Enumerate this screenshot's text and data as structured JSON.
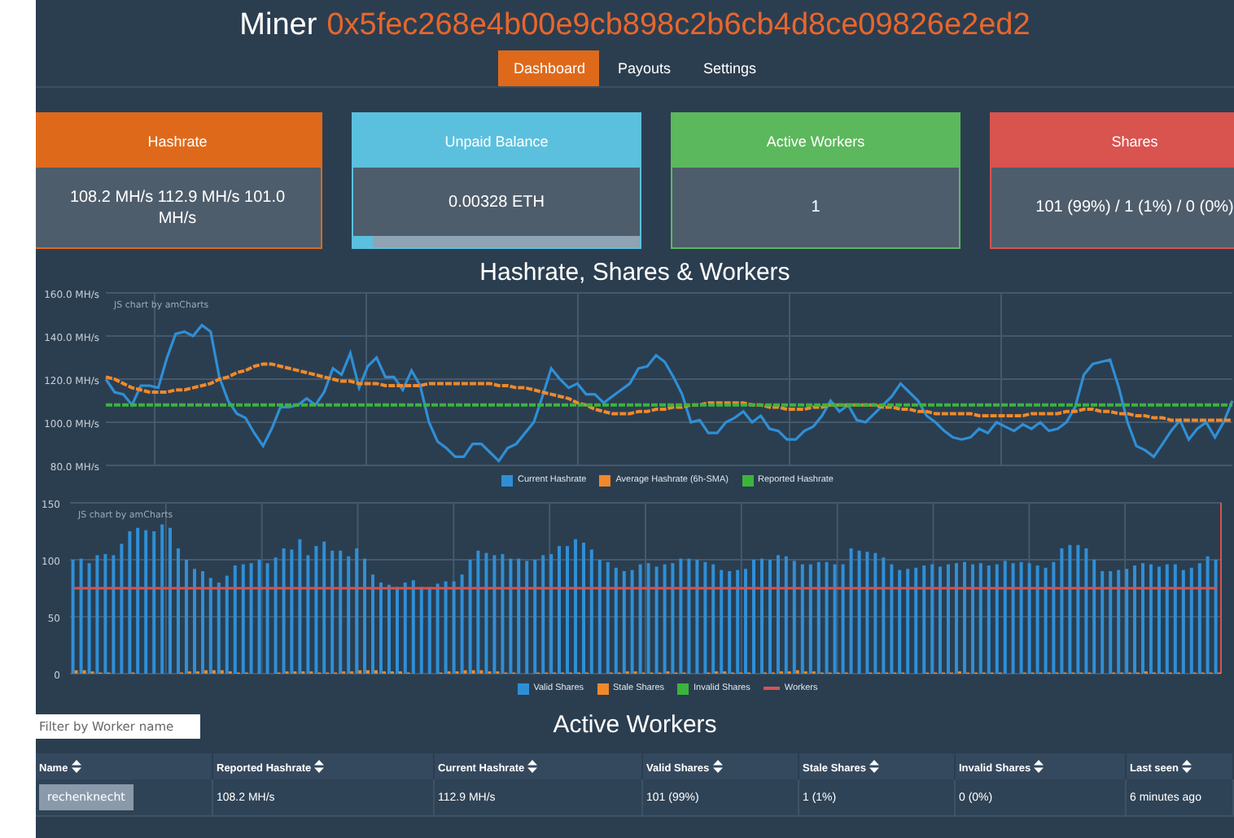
{
  "header": {
    "title_label": "Miner",
    "address": "0x5fec268e4b00e9cb898c2b6cb4d8ce09826e2ed2"
  },
  "tabs": [
    {
      "label": "Dashboard",
      "selected": true
    },
    {
      "label": "Payouts",
      "selected": false
    },
    {
      "label": "Settings",
      "selected": false
    }
  ],
  "cards": [
    {
      "title": "Hashrate",
      "value": "108.2 MH/s 112.9 MH/s 101.0 MH/s",
      "color": "#df691a"
    },
    {
      "title": "Unpaid Balance",
      "value": "0.00328 ETH",
      "color": "#5bc0de",
      "level": 0.07
    },
    {
      "title": "Active Workers",
      "value": "1",
      "color": "#5cb85c"
    },
    {
      "title": "Shares",
      "value": "101 (99%) / 1 (1%) / 0 (0%)",
      "color": "#d9534f"
    }
  ],
  "charts_title": "Hashrate, Shares & Workers",
  "hashrate_chart": {
    "credit": "JS chart by amCharts",
    "chart_data": {
      "type": "line",
      "ylim": [
        80,
        160
      ],
      "grid": true,
      "legend": true,
      "yticks": [
        {
          "value": 80,
          "label": "80.0 MH/s"
        },
        {
          "value": 100,
          "label": "100.0 MH/s"
        },
        {
          "value": 120,
          "label": "120.0 MH/s"
        },
        {
          "value": 140,
          "label": "140.0 MH/s"
        },
        {
          "value": 160,
          "label": "160.0 MH/s"
        }
      ],
      "series": [
        {
          "name": "Current Hashrate",
          "color": "#2f8fd6",
          "line_style": "solid",
          "values": [
            120,
            114,
            113,
            108,
            117,
            117,
            116,
            130,
            141,
            142,
            140,
            145,
            142,
            121,
            110,
            104,
            102,
            95,
            89,
            97,
            107,
            107,
            108,
            111,
            108,
            114,
            125,
            122,
            132,
            116,
            126,
            130,
            121,
            121,
            115,
            124,
            117,
            100,
            91,
            88,
            84,
            84,
            90,
            90,
            86,
            82,
            88,
            90,
            95,
            100,
            112,
            125,
            120,
            116,
            118,
            113,
            113,
            109,
            112,
            115,
            118,
            125,
            126,
            131,
            128,
            121,
            113,
            100,
            101,
            95,
            95,
            100,
            102,
            105,
            100,
            103,
            97,
            96,
            92,
            92,
            96,
            98,
            103,
            110,
            105,
            108,
            101,
            100,
            104,
            108,
            112,
            118,
            114,
            110,
            103,
            100,
            96,
            93,
            92,
            93,
            97,
            95,
            100,
            98,
            96,
            99,
            97,
            100,
            96,
            97,
            100,
            107,
            122,
            127,
            128,
            129,
            116,
            100,
            89,
            87,
            84,
            90,
            96,
            101,
            92,
            97,
            100,
            93,
            100,
            110
          ]
        },
        {
          "name": "Average Hashrate (6h-SMA)",
          "color": "#f0892b",
          "line_style": "dashed",
          "values": [
            121,
            120,
            118,
            116,
            115,
            114,
            114,
            114,
            115,
            115,
            116,
            117,
            118,
            120,
            121,
            123,
            124,
            126,
            127,
            127,
            126,
            125,
            124,
            123,
            122,
            121,
            120,
            119,
            119,
            118,
            118,
            118,
            117,
            117,
            117,
            117,
            117,
            118,
            118,
            118,
            118,
            118,
            118,
            118,
            118,
            117,
            117,
            116,
            116,
            115,
            114,
            113,
            112,
            111,
            109,
            108,
            106,
            105,
            104,
            104,
            104,
            105,
            105,
            106,
            106,
            107,
            107,
            108,
            108,
            109,
            109,
            109,
            109,
            109,
            108,
            108,
            107,
            107,
            106,
            106,
            106,
            107,
            107,
            108,
            108,
            108,
            108,
            108,
            108,
            107,
            107,
            106,
            106,
            105,
            105,
            104,
            104,
            104,
            104,
            104,
            103,
            103,
            103,
            103,
            103,
            103,
            104,
            104,
            104,
            104,
            105,
            105,
            106,
            106,
            105,
            105,
            104,
            104,
            103,
            103,
            102,
            102,
            101,
            101,
            101,
            101,
            101,
            101,
            101,
            101
          ]
        },
        {
          "name": "Reported Hashrate",
          "color": "#3cb43c",
          "line_style": "dashed",
          "values": [
            108,
            108,
            108,
            108,
            108,
            108,
            108,
            108,
            108,
            108,
            108,
            108,
            108,
            108,
            108,
            108,
            108,
            108,
            108,
            108,
            108,
            108,
            108,
            108,
            108,
            108,
            108,
            108,
            108,
            108,
            108,
            108,
            108,
            108,
            108,
            108,
            108,
            108,
            108,
            108,
            108,
            108,
            108,
            108,
            108,
            108,
            108,
            108,
            108,
            108,
            108,
            108,
            108,
            108,
            108,
            108,
            108,
            108,
            108,
            108,
            108,
            108,
            108,
            108,
            108,
            108,
            108,
            108,
            108,
            108,
            108,
            108,
            108,
            108,
            108,
            108,
            108,
            108,
            108,
            108,
            108,
            108,
            108,
            108,
            108,
            108,
            108,
            108,
            108,
            108,
            108,
            108,
            108,
            108,
            108,
            108,
            108,
            108,
            108,
            108,
            108,
            108,
            108,
            108,
            108,
            108,
            108,
            108,
            108,
            108,
            108,
            108,
            108,
            108,
            108,
            108,
            108,
            108,
            108,
            108,
            108,
            108,
            108,
            108,
            108,
            108,
            108,
            108,
            108,
            108
          ]
        }
      ]
    }
  },
  "shares_chart": {
    "credit": "JS chart by amCharts",
    "chart_data": {
      "type": "bar",
      "ylim": [
        0,
        150
      ],
      "yticks": [
        0,
        50,
        100,
        150
      ],
      "stacked": false,
      "grid": true,
      "legend": true,
      "series": [
        {
          "name": "Valid Shares",
          "color": "#2f8fd6",
          "values": [
            100,
            101,
            97,
            104,
            105,
            104,
            114,
            125,
            128,
            126,
            125,
            131,
            128,
            110,
            100,
            92,
            90,
            84,
            80,
            86,
            95,
            96,
            97,
            100,
            97,
            102,
            110,
            109,
            118,
            104,
            112,
            116,
            108,
            108,
            103,
            110,
            101,
            87,
            80,
            78,
            76,
            80,
            82,
            76,
            76,
            79,
            81,
            81,
            87,
            100,
            108,
            106,
            104,
            105,
            101,
            101,
            99,
            100,
            104,
            105,
            112,
            112,
            118,
            115,
            109,
            100,
            98,
            93,
            90,
            91,
            96,
            97,
            94,
            96,
            97,
            101,
            101,
            100,
            98,
            96,
            91,
            90,
            91,
            92,
            100,
            101,
            100,
            104,
            103,
            99,
            96,
            96,
            98,
            98,
            96,
            96,
            110,
            108,
            107,
            106,
            102,
            96,
            91,
            92,
            93,
            95,
            96,
            94,
            96,
            97,
            98,
            96,
            97,
            95,
            96,
            99,
            97,
            98,
            97,
            95,
            93,
            98,
            110,
            113,
            113,
            110,
            100,
            90,
            90,
            91,
            92,
            95,
            97,
            96,
            94,
            96,
            96,
            91,
            93,
            97,
            103,
            100
          ]
        },
        {
          "name": "Stale Shares",
          "color": "#f0892b",
          "values": [
            3,
            3,
            2,
            1,
            1,
            0,
            0,
            1,
            0,
            0,
            0,
            0,
            0,
            1,
            2,
            2,
            3,
            3,
            3,
            2,
            1,
            1,
            0,
            0,
            0,
            1,
            2,
            2,
            2,
            2,
            1,
            1,
            1,
            2,
            2,
            3,
            3,
            3,
            2,
            2,
            2,
            1,
            0,
            0,
            0,
            1,
            2,
            2,
            3,
            3,
            3,
            2,
            2,
            1,
            1,
            0,
            0,
            1,
            1,
            1,
            1,
            1,
            1,
            1,
            0,
            0,
            1,
            1,
            2,
            2,
            1,
            1,
            1,
            2,
            1,
            1,
            0,
            0,
            1,
            2,
            2,
            1,
            1,
            1,
            0,
            1,
            1,
            2,
            2,
            3,
            2,
            2,
            1,
            1,
            1,
            1,
            0,
            0,
            1,
            1,
            1,
            1,
            1,
            0,
            0,
            1,
            1,
            1,
            1,
            2,
            1,
            1,
            1,
            1,
            1,
            0,
            0,
            1,
            1,
            1,
            1,
            1,
            1,
            1,
            1,
            1,
            0,
            0,
            1,
            1,
            1,
            1,
            2,
            1,
            1,
            1,
            1,
            0,
            1,
            1,
            1,
            1
          ]
        },
        {
          "name": "Invalid Shares",
          "color": "#3cb43c",
          "values": [
            0,
            0,
            0,
            0,
            0,
            0,
            0,
            0,
            0,
            0,
            0,
            0,
            0,
            0,
            0,
            0,
            0,
            0,
            0,
            0,
            0,
            0,
            0,
            0,
            0,
            0,
            0,
            0,
            0,
            0,
            0,
            0,
            0,
            0,
            0,
            0,
            0,
            0,
            0,
            0,
            0,
            0,
            0,
            0,
            0,
            0,
            0,
            0,
            0,
            0,
            0,
            0,
            0,
            0,
            0,
            0,
            0,
            0,
            0,
            0,
            0,
            0,
            0,
            0,
            0,
            0,
            0,
            0,
            0,
            0,
            0,
            0,
            0,
            0,
            0,
            0,
            0,
            0,
            0,
            0,
            0,
            0,
            0,
            0,
            0,
            0,
            0,
            0,
            0,
            0,
            0,
            0,
            0,
            0,
            0,
            0,
            0,
            0,
            0,
            0,
            0,
            0,
            0,
            0,
            0,
            0,
            0,
            0,
            0,
            0,
            0,
            0,
            0,
            0,
            0,
            0,
            0,
            0,
            0,
            0,
            0,
            0,
            0,
            0,
            0,
            0,
            0,
            0,
            0,
            0,
            0,
            0,
            0,
            0,
            0,
            0,
            0,
            0,
            0,
            0,
            0,
            0
          ]
        },
        {
          "name": "Workers",
          "color": "#d9534f",
          "type": "line",
          "values": [
            75,
            75,
            75,
            75,
            75,
            75,
            75,
            75,
            75,
            75,
            75,
            75,
            75,
            75,
            75,
            75,
            75,
            75,
            75,
            75,
            75,
            75,
            75,
            75,
            75,
            75,
            75,
            75,
            75,
            75,
            75,
            75,
            75,
            75,
            75,
            75,
            75,
            75,
            75,
            75,
            75,
            75,
            75,
            75,
            75,
            75,
            75,
            75,
            75,
            75,
            75,
            75,
            75,
            75,
            75,
            75,
            75,
            75,
            75,
            75,
            75,
            75,
            75,
            75,
            75,
            75,
            75,
            75,
            75,
            75,
            75,
            75,
            75,
            75,
            75,
            75,
            75,
            75,
            75,
            75,
            75,
            75,
            75,
            75,
            75,
            75,
            75,
            75,
            75,
            75,
            75,
            75,
            75,
            75,
            75,
            75,
            75,
            75,
            75,
            75,
            75,
            75,
            75,
            75,
            75,
            75,
            75,
            75,
            75,
            75,
            75,
            75,
            75,
            75,
            75,
            75,
            75,
            75,
            75,
            75,
            75,
            75,
            75,
            75,
            75,
            75,
            75,
            75,
            75,
            75,
            75,
            75,
            75,
            75,
            75,
            75,
            75,
            75,
            75,
            75,
            75,
            75
          ]
        }
      ]
    }
  },
  "filter": {
    "placeholder": "Filter by Worker name"
  },
  "workers_title": "Active Workers",
  "table": {
    "columns": [
      "Name",
      "Reported Hashrate",
      "Current Hashrate",
      "Valid Shares",
      "Stale Shares",
      "Invalid Shares",
      "Last seen"
    ],
    "rows": [
      [
        "rechenknecht",
        "108.2 MH/s",
        "112.9 MH/s",
        "101 (99%)",
        "1 (1%)",
        "0 (0%)",
        "6 minutes ago"
      ]
    ]
  }
}
